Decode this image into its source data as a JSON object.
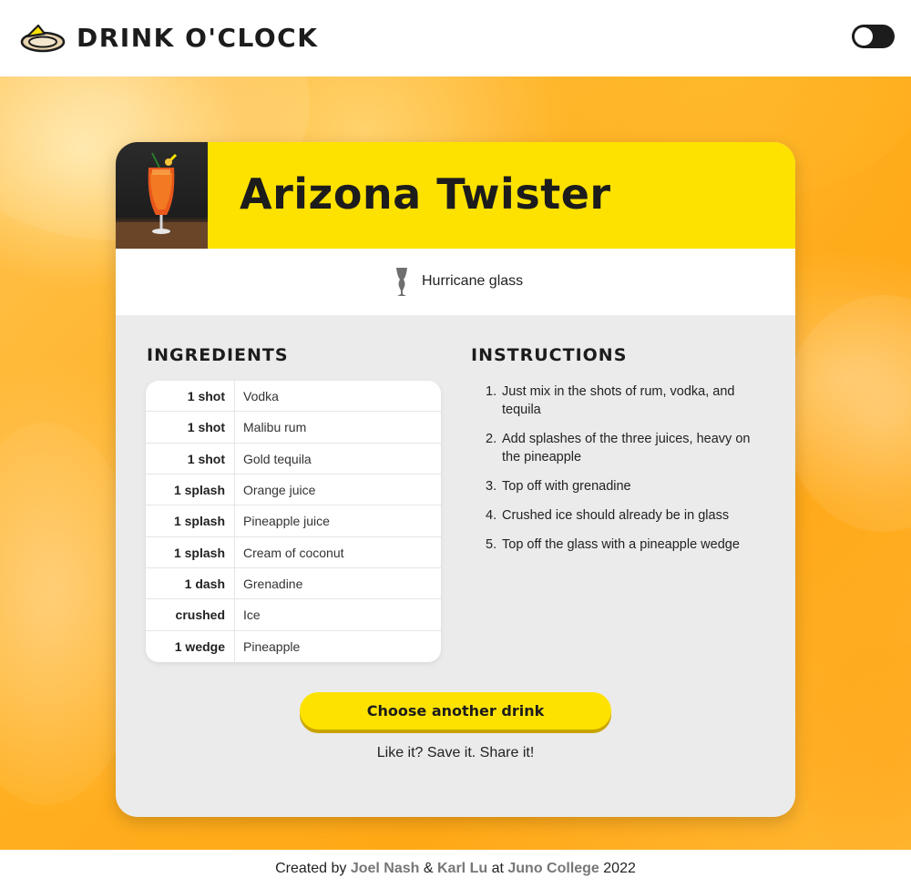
{
  "header": {
    "site_title": "DRINK O'CLOCK",
    "logo_icon": "lemon-wedge-icon",
    "theme_toggle_icon": "toggle-switch-icon"
  },
  "card": {
    "drink_name": "Arizona Twister",
    "glass": {
      "icon": "hurricane-glass-icon",
      "label": "Hurricane glass"
    },
    "ingredients_title": "INGREDIENTS",
    "instructions_title": "INSTRUCTIONS",
    "ingredients": [
      {
        "qty": "1 shot",
        "name": "Vodka"
      },
      {
        "qty": "1 shot",
        "name": "Malibu rum"
      },
      {
        "qty": "1 shot",
        "name": "Gold tequila"
      },
      {
        "qty": "1 splash",
        "name": "Orange juice"
      },
      {
        "qty": "1 splash",
        "name": "Pineapple juice"
      },
      {
        "qty": "1 splash",
        "name": "Cream of coconut"
      },
      {
        "qty": "1 dash",
        "name": "Grenadine"
      },
      {
        "qty": "crushed",
        "name": "Ice"
      },
      {
        "qty": "1 wedge",
        "name": "Pineapple"
      }
    ],
    "instructions": [
      {
        "num": "1.",
        "text": "Just mix in the shots of rum, vodka, and tequila"
      },
      {
        "num": "2.",
        "text": "Add splashes of the three juices, heavy on the pineapple"
      },
      {
        "num": "3.",
        "text": "Top off with grenadine"
      },
      {
        "num": "4.",
        "text": "Crushed ice should already be in glass"
      },
      {
        "num": "5.",
        "text": "Top off the glass with a pineapple wedge"
      }
    ],
    "choose_button": "Choose another drink",
    "save_share": "Like it? Save it. Share it!"
  },
  "footer": {
    "created_by": "Created by",
    "author1": "Joel Nash",
    "amp": "&",
    "author2": "Karl Lu",
    "at": "at",
    "school": "Juno College",
    "year": "2022"
  },
  "colors": {
    "accent_yellow": "#fde200",
    "card_background": "#ebebeb",
    "text_dark": "#1c1c1c",
    "footer_link": "#777777"
  }
}
